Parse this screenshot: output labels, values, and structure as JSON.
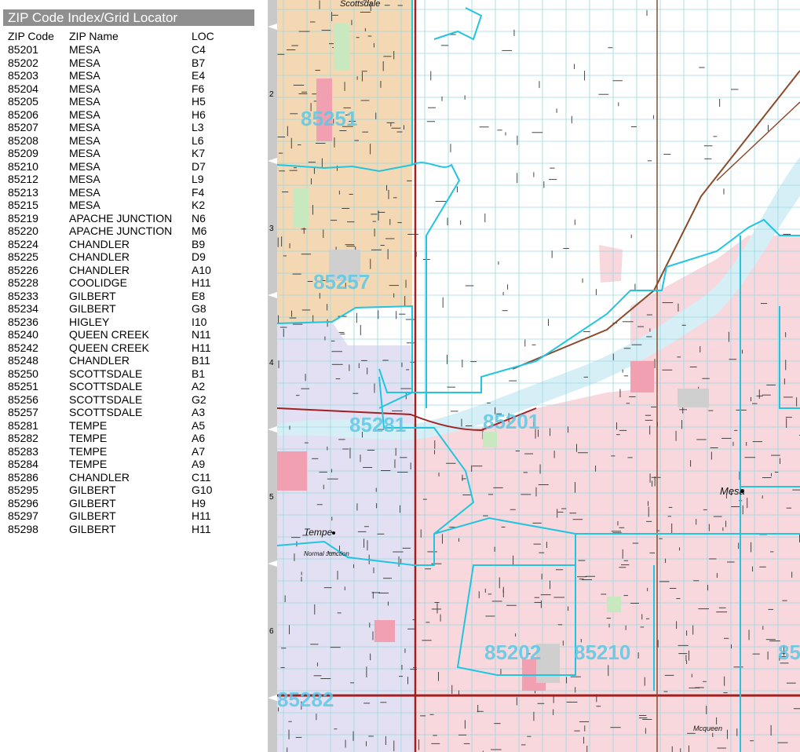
{
  "panel": {
    "title": "ZIP Code Index/Grid Locator",
    "headers": [
      "ZIP Code",
      "ZIP Name",
      "LOC"
    ],
    "rows": [
      [
        "85201",
        "MESA",
        "C4"
      ],
      [
        "85202",
        "MESA",
        "B7"
      ],
      [
        "85203",
        "MESA",
        "E4"
      ],
      [
        "85204",
        "MESA",
        "F6"
      ],
      [
        "85205",
        "MESA",
        "H5"
      ],
      [
        "85206",
        "MESA",
        "H6"
      ],
      [
        "85207",
        "MESA",
        "L3"
      ],
      [
        "85208",
        "MESA",
        "L6"
      ],
      [
        "85209",
        "MESA",
        "K7"
      ],
      [
        "85210",
        "MESA",
        "D7"
      ],
      [
        "85212",
        "MESA",
        "L9"
      ],
      [
        "85213",
        "MESA",
        "F4"
      ],
      [
        "85215",
        "MESA",
        "K2"
      ],
      [
        "85219",
        "APACHE JUNCTION",
        "N6"
      ],
      [
        "85220",
        "APACHE JUNCTION",
        "M6"
      ],
      [
        "85224",
        "CHANDLER",
        "B9"
      ],
      [
        "85225",
        "CHANDLER",
        "D9"
      ],
      [
        "85226",
        "CHANDLER",
        "A10"
      ],
      [
        "85228",
        "COOLIDGE",
        "H11"
      ],
      [
        "85233",
        "GILBERT",
        "E8"
      ],
      [
        "85234",
        "GILBERT",
        "G8"
      ],
      [
        "85236",
        "HIGLEY",
        "I10"
      ],
      [
        "85240",
        "QUEEN CREEK",
        "N11"
      ],
      [
        "85242",
        "QUEEN CREEK",
        "H11"
      ],
      [
        "85248",
        "CHANDLER",
        "B11"
      ],
      [
        "85250",
        "SCOTTSDALE",
        "B1"
      ],
      [
        "85251",
        "SCOTTSDALE",
        "A2"
      ],
      [
        "85256",
        "SCOTTSDALE",
        "G2"
      ],
      [
        "85257",
        "SCOTTSDALE",
        "A3"
      ],
      [
        "85281",
        "TEMPE",
        "A5"
      ],
      [
        "85282",
        "TEMPE",
        "A6"
      ],
      [
        "85283",
        "TEMPE",
        "A7"
      ],
      [
        "85284",
        "TEMPE",
        "A9"
      ],
      [
        "85286",
        "CHANDLER",
        "C11"
      ],
      [
        "85295",
        "GILBERT",
        "G10"
      ],
      [
        "85296",
        "GILBERT",
        "H9"
      ],
      [
        "85297",
        "GILBERT",
        "H11"
      ],
      [
        "85298",
        "GILBERT",
        "H11"
      ]
    ]
  },
  "grid_rows": [
    "2",
    "3",
    "4",
    "5",
    "6"
  ],
  "map": {
    "places": [
      "Scottsdale",
      "Tempe",
      "Normal Junction",
      "Mesa",
      "Mcqueen"
    ],
    "zip_labels": [
      "85251",
      "85257",
      "85281",
      "85201",
      "85202",
      "85210",
      "85282",
      "85"
    ],
    "colors": {
      "scottsdale": "#f4d8b4",
      "tempe": "#e4e0f4",
      "mesa": "#f8d8dc",
      "unincorporated": "#ffffff",
      "zip_boundary": "#22c4e0",
      "river": "#d8eef4",
      "park": "#c8e8c0",
      "golf": "#f0a0b0",
      "freeway": "#a02020",
      "railroad": "#8b4a2a"
    }
  }
}
